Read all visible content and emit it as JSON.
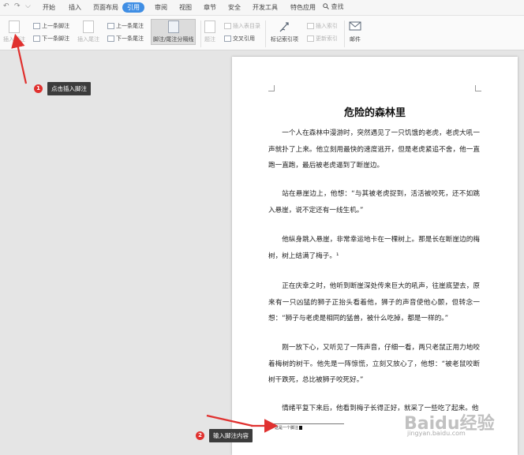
{
  "menubar": {
    "nav_icons": [
      "↶",
      "↷",
      "⌵"
    ],
    "tabs": [
      "开始",
      "插入",
      "页面布局",
      "引用",
      "审阅",
      "视图",
      "章节",
      "安全",
      "开发工具",
      "特色应用"
    ],
    "active_tab": "引用",
    "search_icon": "search-icon",
    "search_label": "查找"
  },
  "ribbon": {
    "insert_footnote": "插入脚注",
    "prev_footnote": "上一条脚注",
    "next_footnote": "下一条脚注",
    "insert_endnote": "插入尾注",
    "prev_endnote": "上一条尾注",
    "next_endnote": "下一条尾注",
    "separator_line": "脚注/尾注分隔线",
    "caption": "题注",
    "insert_table_of_figures": "插入表目录",
    "cross_reference": "交叉引用",
    "mark_index_entry": "标记索引项",
    "insert_index": "插入索引",
    "update_index": "更新索引",
    "mail": "邮件"
  },
  "document": {
    "title": "危险的森林里",
    "paragraphs": [
      "一个人在森林中漫游时，突然遇见了一只饥饿的老虎，老虎大吼一声就扑了上来。他立刻用最快的速度逃开，但是老虎紧追不舍，他一直跑一直跑，最后被老虎逼到了断崖边。",
      "站在悬崖边上，他想：“与其被老虎捉到，活活被咬死，还不如跳入悬崖，说不定还有一线生机。”",
      "他纵身跳入悬崖，非常幸运地卡在一棵树上。那是长在断崖边的梅树，树上结满了梅子。¹",
      "正在庆幸之时，他听到断崖深处传来巨大的吼声，往崖底望去，原来有一只凶猛的狮子正抬头看着他，狮子的声音使他心颤，但转念一想：“狮子与老虎是相同的猛兽，被什么吃掉，都是一样的。”",
      "刚一放下心，又听见了一阵声音，仔细一看，两只老鼠正用力地咬着梅树的树干。他先是一阵惊慌，立刻又放心了，他想：“被老鼠咬断树干跌死，总比被狮子咬死好。”",
      "情绪平复下来后，他看到梅子长得正好，就采了一些吃了起来。他"
    ],
    "footnote_text": "¹这是一个脚注"
  },
  "annotations": [
    {
      "number": "1",
      "label": "点击插入脚注"
    },
    {
      "number": "2",
      "label": "输入脚注内容"
    }
  ],
  "watermark": {
    "brand": "Baidu经验",
    "sub": "jingyan.baidu.com"
  },
  "colors": {
    "active_tab": "#3f8ee4",
    "annotation_badge": "#e0312f",
    "annotation_arrow": "#e0312f",
    "label_bg": "#3c3c3c"
  }
}
